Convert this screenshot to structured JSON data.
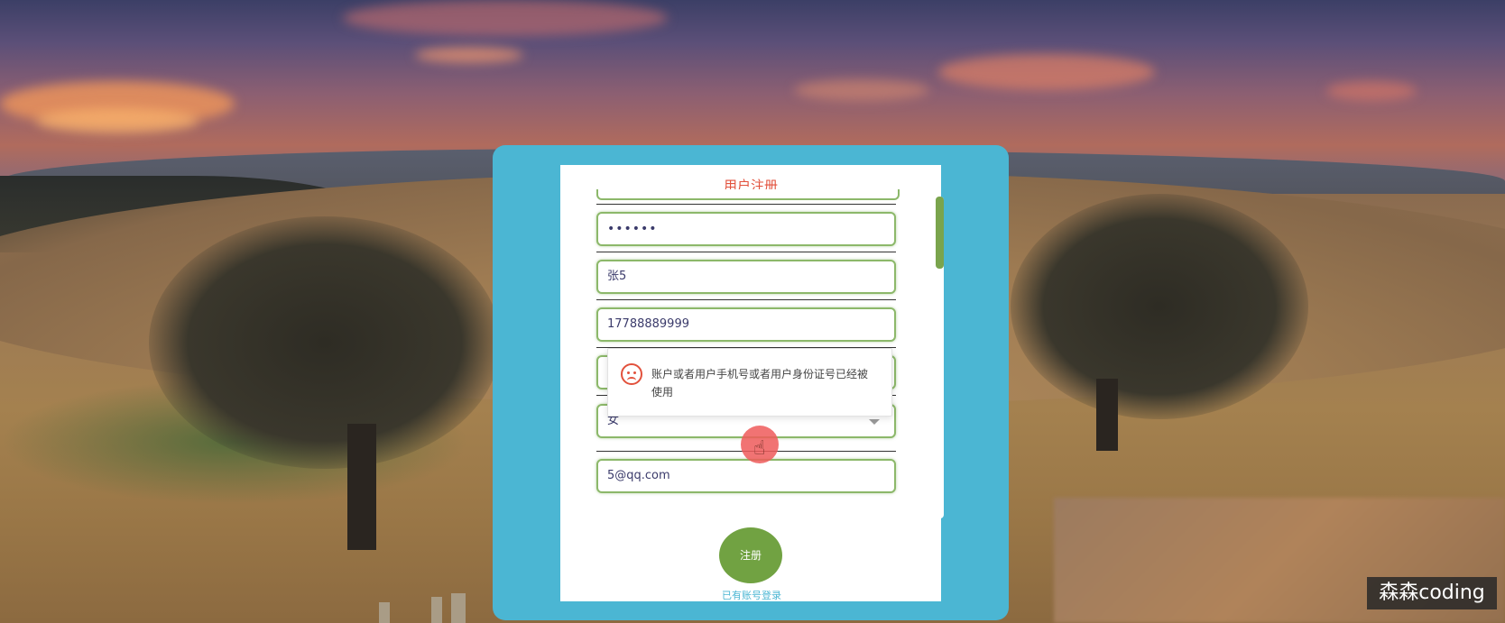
{
  "form": {
    "title": "用户注册",
    "fields": [
      {
        "name": "password",
        "value": "••••••"
      },
      {
        "name": "real-name",
        "value": "张5"
      },
      {
        "name": "phone",
        "value": "17788889999"
      },
      {
        "name": "gender",
        "value": "女"
      },
      {
        "name": "email",
        "value": "5@qq.com"
      }
    ],
    "submit_label": "注册",
    "login_link": "已有账号登录"
  },
  "error_popup": {
    "icon": "sad-face-icon",
    "message": "账户或者用户手机号或者用户身份证号已经被使用",
    "color": "#e2513c"
  },
  "watermark": "森森coding",
  "colors": {
    "modal_bg": "#4bb6d3",
    "accent_green": "#71a242",
    "input_border": "#8cb86a",
    "title_red": "#e2513c"
  }
}
